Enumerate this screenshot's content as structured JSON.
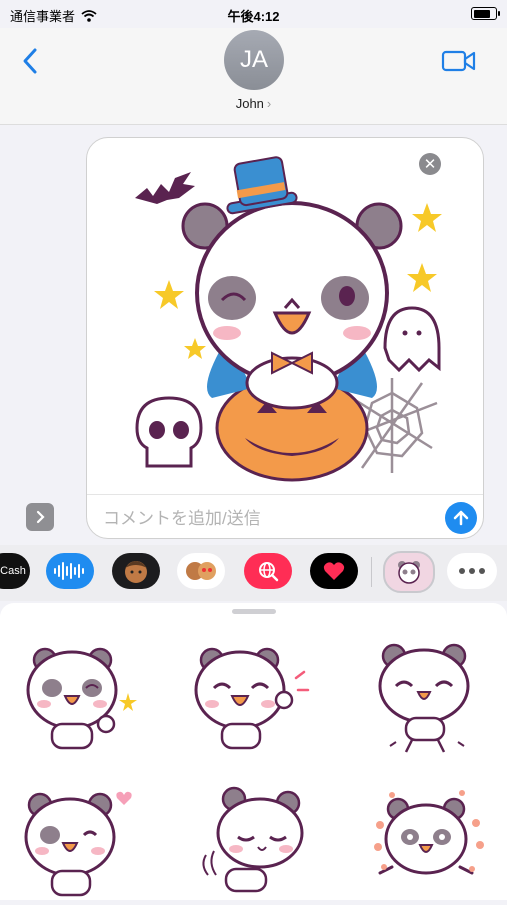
{
  "status": {
    "carrier": "通信事業者",
    "time": "午後4:12"
  },
  "header": {
    "avatar_initials": "JA",
    "contact_name": "John",
    "contact_chevron": "›"
  },
  "compose": {
    "placeholder": "コメントを追加/送信",
    "remove_glyph": "✕"
  },
  "app_drawer": {
    "items": [
      {
        "name": "apple-cash",
        "label": "Cash"
      },
      {
        "name": "audio-message"
      },
      {
        "name": "memoji-1"
      },
      {
        "name": "memoji-2"
      },
      {
        "name": "web-images"
      },
      {
        "name": "digital-touch"
      },
      {
        "name": "panda-sticker-app"
      },
      {
        "name": "more-apps"
      }
    ]
  },
  "sticker_panel": {
    "stickers": [
      {
        "name": "panda-wink-thumbs-up"
      },
      {
        "name": "panda-waving"
      },
      {
        "name": "panda-dancing"
      },
      {
        "name": "panda-heart-hands"
      },
      {
        "name": "panda-bowing"
      },
      {
        "name": "panda-flowers-joy"
      }
    ]
  },
  "colors": {
    "accent": "#1f8cf0",
    "panda_outline": "#5a2350",
    "panda_patch": "#8e7f8c",
    "pumpkin": "#f39a4a",
    "hat": "#3a8fd1",
    "star": "#f7c928"
  }
}
